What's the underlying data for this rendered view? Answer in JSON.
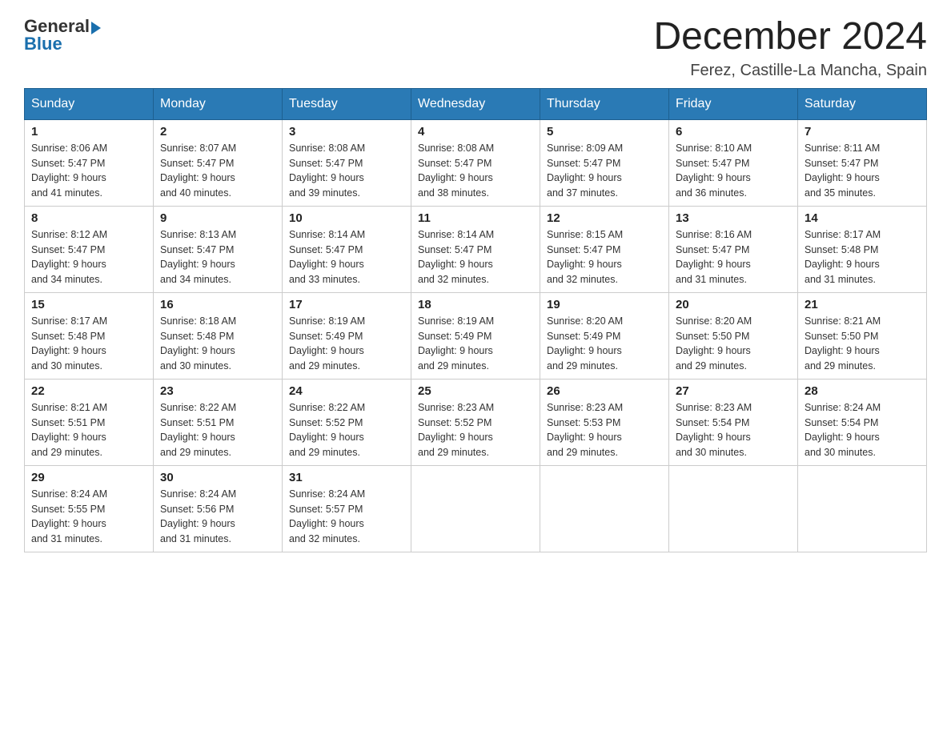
{
  "header": {
    "logo": {
      "text_general": "General",
      "text_blue": "Blue",
      "arrow": true
    },
    "month_title": "December 2024",
    "location": "Ferez, Castille-La Mancha, Spain"
  },
  "weekdays": [
    "Sunday",
    "Monday",
    "Tuesday",
    "Wednesday",
    "Thursday",
    "Friday",
    "Saturday"
  ],
  "weeks": [
    [
      {
        "day": 1,
        "sunrise": "8:06 AM",
        "sunset": "5:47 PM",
        "daylight": "9 hours and 41 minutes."
      },
      {
        "day": 2,
        "sunrise": "8:07 AM",
        "sunset": "5:47 PM",
        "daylight": "9 hours and 40 minutes."
      },
      {
        "day": 3,
        "sunrise": "8:08 AM",
        "sunset": "5:47 PM",
        "daylight": "9 hours and 39 minutes."
      },
      {
        "day": 4,
        "sunrise": "8:08 AM",
        "sunset": "5:47 PM",
        "daylight": "9 hours and 38 minutes."
      },
      {
        "day": 5,
        "sunrise": "8:09 AM",
        "sunset": "5:47 PM",
        "daylight": "9 hours and 37 minutes."
      },
      {
        "day": 6,
        "sunrise": "8:10 AM",
        "sunset": "5:47 PM",
        "daylight": "9 hours and 36 minutes."
      },
      {
        "day": 7,
        "sunrise": "8:11 AM",
        "sunset": "5:47 PM",
        "daylight": "9 hours and 35 minutes."
      }
    ],
    [
      {
        "day": 8,
        "sunrise": "8:12 AM",
        "sunset": "5:47 PM",
        "daylight": "9 hours and 34 minutes."
      },
      {
        "day": 9,
        "sunrise": "8:13 AM",
        "sunset": "5:47 PM",
        "daylight": "9 hours and 34 minutes."
      },
      {
        "day": 10,
        "sunrise": "8:14 AM",
        "sunset": "5:47 PM",
        "daylight": "9 hours and 33 minutes."
      },
      {
        "day": 11,
        "sunrise": "8:14 AM",
        "sunset": "5:47 PM",
        "daylight": "9 hours and 32 minutes."
      },
      {
        "day": 12,
        "sunrise": "8:15 AM",
        "sunset": "5:47 PM",
        "daylight": "9 hours and 32 minutes."
      },
      {
        "day": 13,
        "sunrise": "8:16 AM",
        "sunset": "5:47 PM",
        "daylight": "9 hours and 31 minutes."
      },
      {
        "day": 14,
        "sunrise": "8:17 AM",
        "sunset": "5:48 PM",
        "daylight": "9 hours and 31 minutes."
      }
    ],
    [
      {
        "day": 15,
        "sunrise": "8:17 AM",
        "sunset": "5:48 PM",
        "daylight": "9 hours and 30 minutes."
      },
      {
        "day": 16,
        "sunrise": "8:18 AM",
        "sunset": "5:48 PM",
        "daylight": "9 hours and 30 minutes."
      },
      {
        "day": 17,
        "sunrise": "8:19 AM",
        "sunset": "5:49 PM",
        "daylight": "9 hours and 29 minutes."
      },
      {
        "day": 18,
        "sunrise": "8:19 AM",
        "sunset": "5:49 PM",
        "daylight": "9 hours and 29 minutes."
      },
      {
        "day": 19,
        "sunrise": "8:20 AM",
        "sunset": "5:49 PM",
        "daylight": "9 hours and 29 minutes."
      },
      {
        "day": 20,
        "sunrise": "8:20 AM",
        "sunset": "5:50 PM",
        "daylight": "9 hours and 29 minutes."
      },
      {
        "day": 21,
        "sunrise": "8:21 AM",
        "sunset": "5:50 PM",
        "daylight": "9 hours and 29 minutes."
      }
    ],
    [
      {
        "day": 22,
        "sunrise": "8:21 AM",
        "sunset": "5:51 PM",
        "daylight": "9 hours and 29 minutes."
      },
      {
        "day": 23,
        "sunrise": "8:22 AM",
        "sunset": "5:51 PM",
        "daylight": "9 hours and 29 minutes."
      },
      {
        "day": 24,
        "sunrise": "8:22 AM",
        "sunset": "5:52 PM",
        "daylight": "9 hours and 29 minutes."
      },
      {
        "day": 25,
        "sunrise": "8:23 AM",
        "sunset": "5:52 PM",
        "daylight": "9 hours and 29 minutes."
      },
      {
        "day": 26,
        "sunrise": "8:23 AM",
        "sunset": "5:53 PM",
        "daylight": "9 hours and 29 minutes."
      },
      {
        "day": 27,
        "sunrise": "8:23 AM",
        "sunset": "5:54 PM",
        "daylight": "9 hours and 30 minutes."
      },
      {
        "day": 28,
        "sunrise": "8:24 AM",
        "sunset": "5:54 PM",
        "daylight": "9 hours and 30 minutes."
      }
    ],
    [
      {
        "day": 29,
        "sunrise": "8:24 AM",
        "sunset": "5:55 PM",
        "daylight": "9 hours and 31 minutes."
      },
      {
        "day": 30,
        "sunrise": "8:24 AM",
        "sunset": "5:56 PM",
        "daylight": "9 hours and 31 minutes."
      },
      {
        "day": 31,
        "sunrise": "8:24 AM",
        "sunset": "5:57 PM",
        "daylight": "9 hours and 32 minutes."
      },
      null,
      null,
      null,
      null
    ]
  ],
  "labels": {
    "sunrise": "Sunrise:",
    "sunset": "Sunset:",
    "daylight": "Daylight:"
  }
}
